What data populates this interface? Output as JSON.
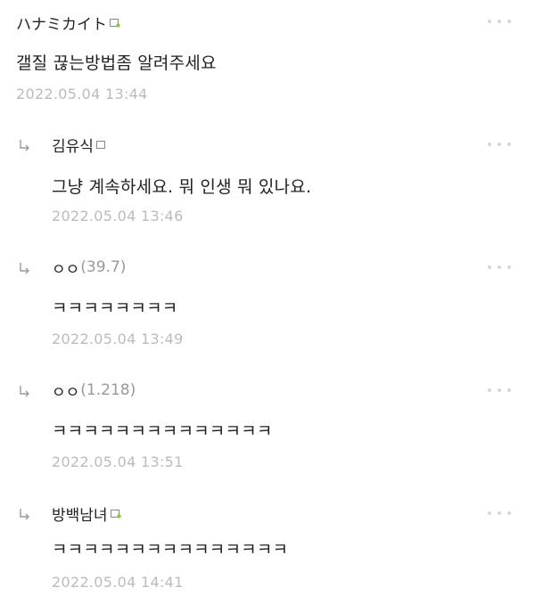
{
  "comments": [
    {
      "nickname": "ハナミカイト",
      "ip": "",
      "has_badge": true,
      "text": "갤질 끊는방법좀 알려주세요",
      "date": "2022.05.04 13:44",
      "is_reply": false
    },
    {
      "nickname": "김유식",
      "ip": "",
      "has_badge": true,
      "text": "그냥 계속하세요. 뭐 인생 뭐 있나요.",
      "date": "2022.05.04 13:46",
      "is_reply": true
    },
    {
      "nickname": "ㅇㅇ",
      "ip": "(39.7)",
      "has_badge": false,
      "text": "ㅋㅋㅋㅋㅋㅋㅋㅋ",
      "date": "2022.05.04 13:49",
      "is_reply": true
    },
    {
      "nickname": "ㅇㅇ",
      "ip": "(1.218)",
      "has_badge": false,
      "text": "ㅋㅋㅋㅋㅋㅋㅋㅋㅋㅋㅋㅋㅋㅋ",
      "date": "2022.05.04 13:51",
      "is_reply": true
    },
    {
      "nickname": "방백남녀",
      "ip": "",
      "has_badge": true,
      "text": "ㅋㅋㅋㅋㅋㅋㅋㅋㅋㅋㅋㅋㅋㅋㅋ",
      "date": "2022.05.04 14:41",
      "is_reply": true
    }
  ],
  "icons": {
    "reply_arrow": "reply-arrow-icon",
    "more": "more-options-icon",
    "badge": "gallog-badge-icon"
  },
  "colors": {
    "text": "#222222",
    "date": "#bbbbbb",
    "ip": "#999999",
    "badge": "#8cc63f"
  }
}
